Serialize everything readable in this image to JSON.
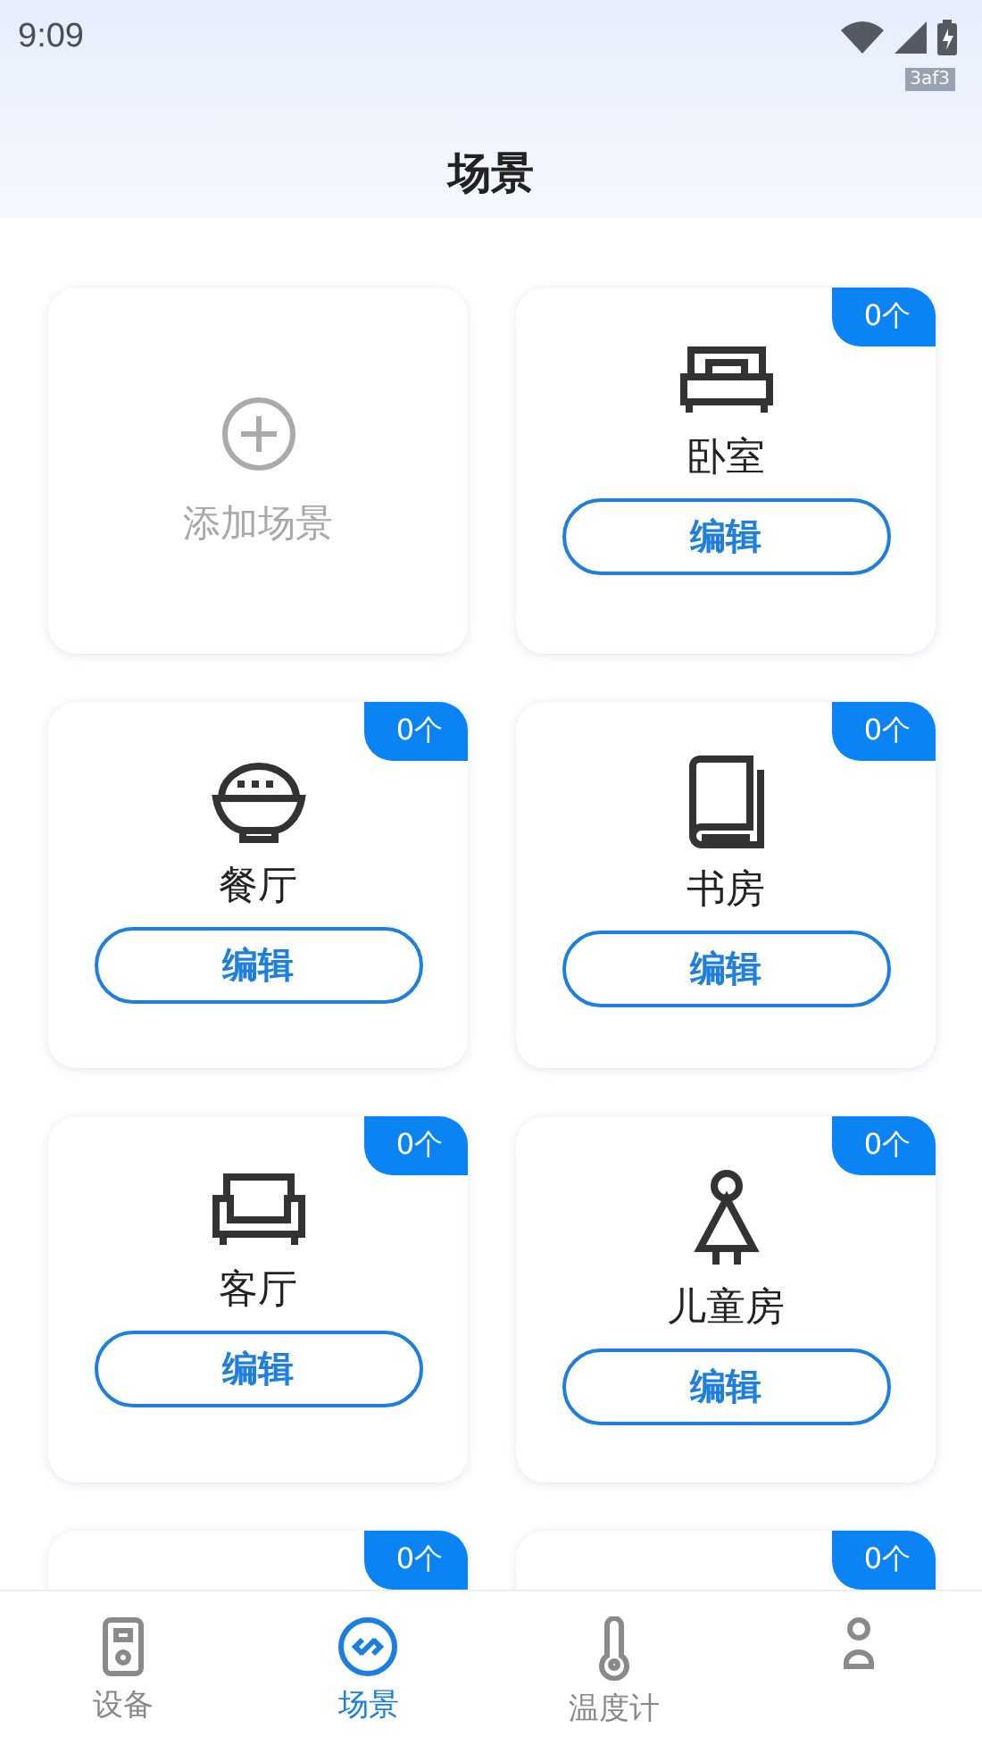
{
  "status_bar": {
    "time": "9:09",
    "tag": "3af3"
  },
  "header": {
    "title": "场景"
  },
  "cards": [
    {
      "kind": "add",
      "label": "添加场景"
    },
    {
      "kind": "room",
      "count": "0个",
      "name": "卧室",
      "button": "编辑"
    },
    {
      "kind": "room",
      "count": "0个",
      "name": "餐厅",
      "button": "编辑"
    },
    {
      "kind": "room",
      "count": "0个",
      "name": "书房",
      "button": "编辑"
    },
    {
      "kind": "room",
      "count": "0个",
      "name": "客厅",
      "button": "编辑"
    },
    {
      "kind": "room",
      "count": "0个",
      "name": "儿童房",
      "button": "编辑"
    },
    {
      "kind": "room",
      "count": "0个"
    },
    {
      "kind": "room",
      "count": "0个"
    }
  ],
  "tabs": [
    {
      "label": "设备",
      "selected": false
    },
    {
      "label": "场景",
      "selected": true
    },
    {
      "label": "温度计",
      "selected": false
    },
    {
      "selected": false
    }
  ]
}
